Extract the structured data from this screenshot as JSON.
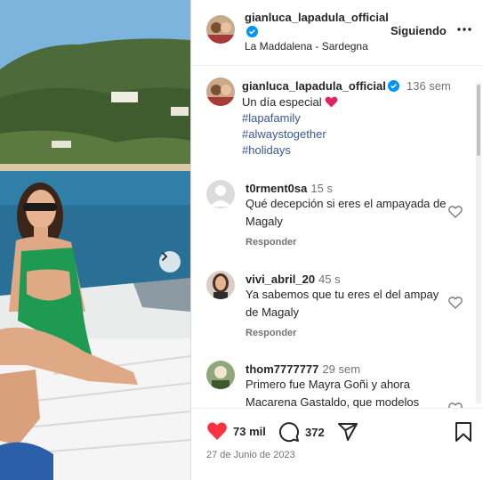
{
  "post": {
    "username": "gianluca_lapadula_official",
    "location": "La Maddalena - Sardegna",
    "follow_label": "Siguiendo"
  },
  "caption": {
    "username": "gianluca_lapadula_official",
    "time": "136 sem",
    "text": "Un día especial",
    "hashtags": [
      "#lapafamily",
      "#alwaystogether",
      "#holidays"
    ]
  },
  "comments": [
    {
      "username": "t0rment0sa",
      "time": "15 s",
      "text": "Qué decepción si eres el ampayada de Magaly",
      "reply_label": "Responder"
    },
    {
      "username": "vivi_abril_20",
      "time": "45 s",
      "text": "Ya sabemos que tu eres el del ampay de Magaly",
      "reply_label": "Responder"
    },
    {
      "username": "thom7777777",
      "time": "29 sem",
      "text": "Primero fue Mayra Goñi y ahora Macarena Gastaldo, que modelos",
      "reply_label": ""
    }
  ],
  "actions": {
    "likes": "73 mil",
    "comments": "372",
    "date": "27 de Junio de 2023"
  },
  "icons": {
    "verified": "verified-badge-icon",
    "more": "more-options-icon",
    "heart": "heart-icon",
    "comment": "comment-icon",
    "share": "share-icon",
    "save": "bookmark-icon",
    "next": "chevron-right-icon"
  },
  "colors": {
    "verified": "#0095f6",
    "liked_heart": "#ff3040",
    "hashtag": "#385898"
  }
}
